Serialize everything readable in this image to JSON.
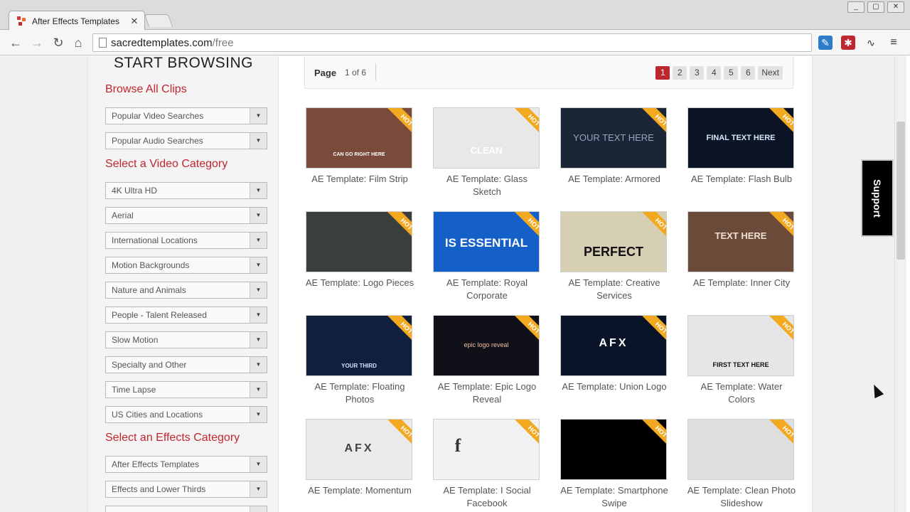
{
  "browser": {
    "tab_title": "After Effects Templates",
    "url_host": "sacredtemplates.com",
    "url_path": "/free",
    "window_controls": [
      "_",
      "▢",
      "✕"
    ]
  },
  "sidebar": {
    "heading": "START BROWSING",
    "sections": [
      {
        "title": "Browse All Clips",
        "items": [
          "Popular Video Searches",
          "Popular Audio Searches"
        ]
      },
      {
        "title": "Select a Video Category",
        "items": [
          "4K Ultra HD",
          "Aerial",
          "International Locations",
          "Motion Backgrounds",
          "Nature and Animals",
          "People - Talent Released",
          "Slow Motion",
          "Specialty and Other",
          "Time Lapse",
          "US Cities and Locations"
        ]
      },
      {
        "title": "Select an Effects Category",
        "items": [
          "After Effects Templates",
          "Effects and Lower Thirds"
        ]
      }
    ]
  },
  "pager": {
    "label": "Page",
    "count": "1 of 6",
    "pages": [
      "1",
      "2",
      "3",
      "4",
      "5",
      "6"
    ],
    "next": "Next",
    "current": "1"
  },
  "badge": "HOT",
  "cards": [
    {
      "label": "AE Template: Film Strip",
      "thumb_text": "CAN GO RIGHT HERE",
      "bg": "#7a4a3a",
      "fg": "#fff"
    },
    {
      "label": "AE Template: Glass Sketch",
      "thumb_text": "CLEAN",
      "bg": "#e8e8e8",
      "fg": "#fff"
    },
    {
      "label": "AE Template: Armored",
      "thumb_text": "YOUR TEXT HERE",
      "bg": "#1a2636",
      "fg": "#8fa7bf"
    },
    {
      "label": "AE Template: Flash Bulb",
      "thumb_text": "FINAL TEXT HERE",
      "bg": "#0b1424",
      "fg": "#d9e6ff"
    },
    {
      "label": "AE Template: Logo Pieces",
      "thumb_text": "",
      "bg": "#3a3f3c",
      "fg": "#fff"
    },
    {
      "label": "AE Template: Royal Corporate",
      "thumb_text": "IS ESSENTIAL",
      "bg": "#1560c8",
      "fg": "#ffffff"
    },
    {
      "label": "AE Template: Creative Services",
      "thumb_text": "PERFECT",
      "bg": "#d6cfb4",
      "fg": "#111"
    },
    {
      "label": "AE Template: Inner City",
      "thumb_text": "TEXT HERE",
      "bg": "#6a4a38",
      "fg": "#f0e0d0"
    },
    {
      "label": "AE Template: Floating Photos",
      "thumb_text": "YOUR THIRD",
      "bg": "#10203c",
      "fg": "#cfe2ff"
    },
    {
      "label": "AE Template: Epic Logo Reveal",
      "thumb_text": "epic logo reveal",
      "bg": "#101018",
      "fg": "#f0c0a0"
    },
    {
      "label": "AE Template: Union Logo",
      "thumb_text": "AFX",
      "bg": "#0a1428",
      "fg": "#ffffff"
    },
    {
      "label": "AE Template: Water Colors",
      "thumb_text": "FIRST TEXT HERE",
      "bg": "#e6e6e6",
      "fg": "#111"
    },
    {
      "label": "AE Template: Momentum",
      "thumb_text": "AFX",
      "bg": "#eaeaea",
      "fg": "#444"
    },
    {
      "label": "AE Template: I Social Facebook",
      "thumb_text": "f",
      "bg": "#f2f2f2",
      "fg": "#333"
    },
    {
      "label": "AE Template: Smartphone Swipe",
      "thumb_text": "",
      "bg": "#000000",
      "fg": "#fff"
    },
    {
      "label": "AE Template: Clean Photo Slideshow",
      "thumb_text": "",
      "bg": "#dedede",
      "fg": "#222"
    }
  ],
  "support": {
    "label": "Support"
  },
  "colors": {
    "accent": "#c0262e",
    "hot": "#f2a81f",
    "support_bg": "#000000"
  }
}
